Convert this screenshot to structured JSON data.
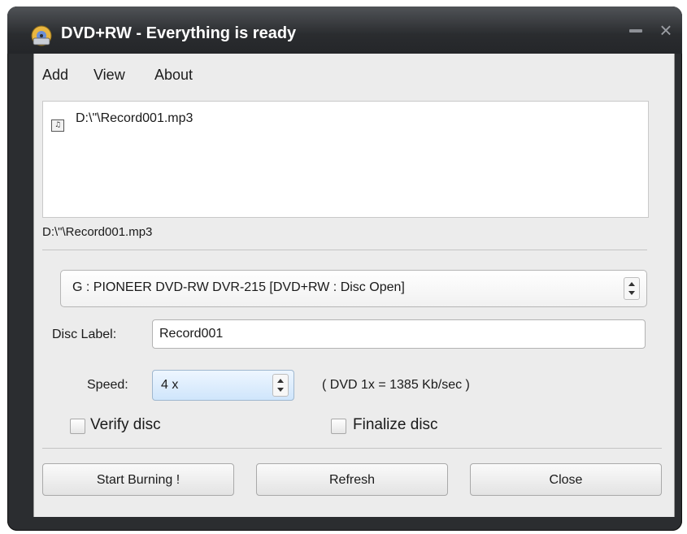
{
  "window": {
    "title": "DVD+RW - Everything is ready",
    "minimize_symbol": "",
    "close_symbol": "×"
  },
  "menu": [
    {
      "label": "Add"
    },
    {
      "label": "View"
    },
    {
      "label": "About"
    }
  ],
  "files": [
    {
      "icon": "audio-file-icon",
      "icon_glyph": "♫",
      "name": "D:\\\"\\Record001.mp3"
    }
  ],
  "selected_path": "D:\\\"\\Record001.mp3",
  "drive": {
    "value": "G : PIONEER  DVD-RW  DVR-215     [DVD+RW : Disc Open]"
  },
  "disc_label": {
    "label": "Disc Label:",
    "value": "Record001"
  },
  "speed": {
    "label": "Speed:",
    "value": "4 x",
    "note": "( DVD 1x = 1385 Kb/sec )"
  },
  "options": {
    "verify": {
      "label": "Verify disc",
      "checked": false
    },
    "finalize": {
      "label": "Finalize disc",
      "checked": false
    }
  },
  "buttons": {
    "start": "Start Burning !",
    "refresh": "Refresh",
    "close": "Close"
  },
  "colors": {
    "titlebar": "#2b2d30",
    "client_bg": "#ececec",
    "speed_highlight": "#cfe5fb"
  }
}
